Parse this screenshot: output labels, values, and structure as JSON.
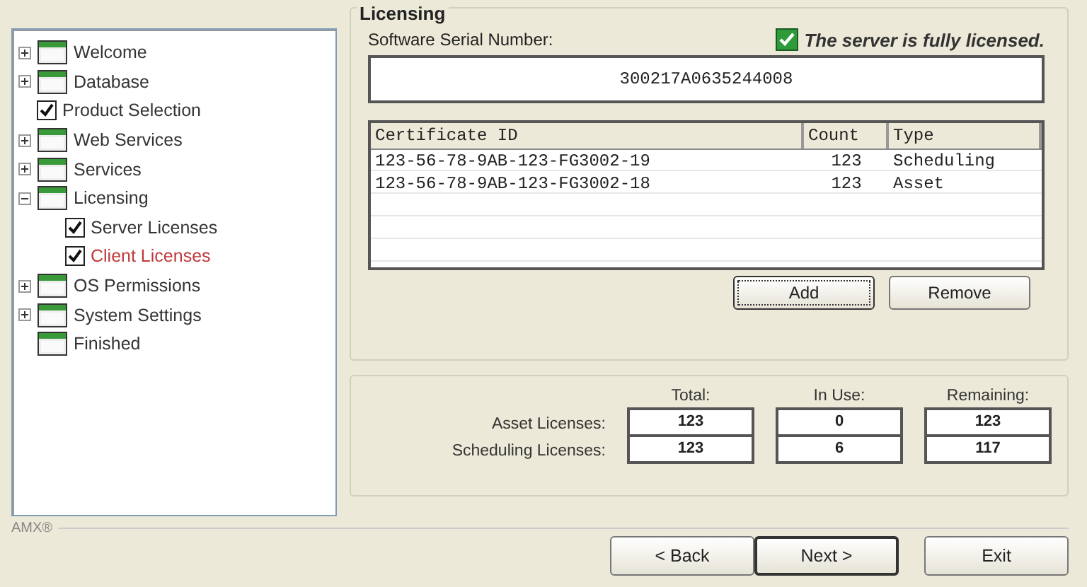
{
  "tree": [
    {
      "kind": "page",
      "label": "Welcome",
      "expanded": false,
      "selected": false
    },
    {
      "kind": "page",
      "label": "Database",
      "expanded": false,
      "selected": false
    },
    {
      "kind": "check",
      "label": "Product Selection",
      "checked": true,
      "selected": false
    },
    {
      "kind": "page",
      "label": "Web Services",
      "expanded": false,
      "selected": false
    },
    {
      "kind": "page",
      "label": "Services",
      "expanded": false,
      "selected": false
    },
    {
      "kind": "page",
      "label": "Licensing",
      "expanded": true,
      "selected": false,
      "children": [
        {
          "kind": "check",
          "label": "Server Licenses",
          "checked": true,
          "selected": false
        },
        {
          "kind": "check",
          "label": "Client Licenses",
          "checked": true,
          "selected": true
        }
      ]
    },
    {
      "kind": "page",
      "label": "OS Permissions",
      "expanded": false,
      "selected": false
    },
    {
      "kind": "page",
      "label": "System Settings",
      "expanded": false,
      "selected": false
    },
    {
      "kind": "leaf",
      "label": "Finished",
      "selected": false
    }
  ],
  "licensing": {
    "title": "Licensing",
    "serial_label": "Software Serial Number:",
    "status": {
      "text": "The server is fully licensed.",
      "licensed": true
    },
    "serial": "300217A0635244008",
    "table": {
      "columns": [
        "Certificate ID",
        "Count",
        "Type"
      ],
      "rows": [
        [
          "123-56-78-9AB-123-FG3002-19",
          "123",
          "Scheduling"
        ],
        [
          "123-56-78-9AB-123-FG3002-18",
          "123",
          "Asset"
        ]
      ]
    },
    "buttons": [
      "Add",
      "Remove"
    ]
  },
  "totals": {
    "columns": [
      "Total:",
      "In Use:",
      "Remaining:"
    ],
    "rows": [
      {
        "label": "Asset Licenses:",
        "values": [
          "123",
          "0",
          "123"
        ]
      },
      {
        "label": "Scheduling Licenses:",
        "values": [
          "123",
          "6",
          "117"
        ]
      }
    ]
  },
  "brand": "AMX®",
  "nav": [
    {
      "label": "< Back",
      "default": false
    },
    {
      "label": "Next >",
      "default": true
    },
    {
      "label": "Exit",
      "default": false
    }
  ]
}
